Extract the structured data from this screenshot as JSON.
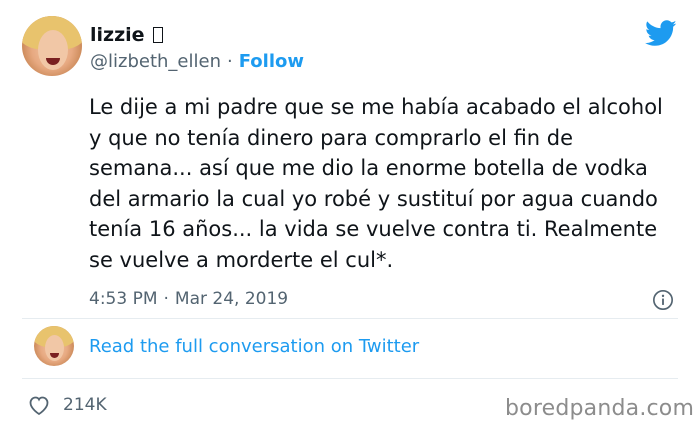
{
  "tweet": {
    "display_name": "lizzie",
    "handle": "@lizbeth_ellen",
    "follow_label": "Follow",
    "text": "Le dije a mi padre que se me había acabado el alcohol y que no tenía dinero para comprarlo el fin de semana... así que me dio la enorme botella de vodka del armario la cual yo robé y sustituí por agua cuando tenía 16 años... la vida se vuelve contra ti. Realmente se vuelve a morderte el cul*.",
    "time": "4:53 PM",
    "separator": "·",
    "date": "Mar 24, 2019",
    "read_full_label": "Read the full conversation on Twitter",
    "like_count": "214K"
  },
  "watermark": "boredpanda.com",
  "icons": {
    "brand": "twitter-bird-icon",
    "info": "info-icon",
    "like": "heart-icon"
  },
  "colors": {
    "accent": "#1d9bf0",
    "text": "#0f1419",
    "secondary": "#536471",
    "watermark": "#8c8c8c"
  }
}
